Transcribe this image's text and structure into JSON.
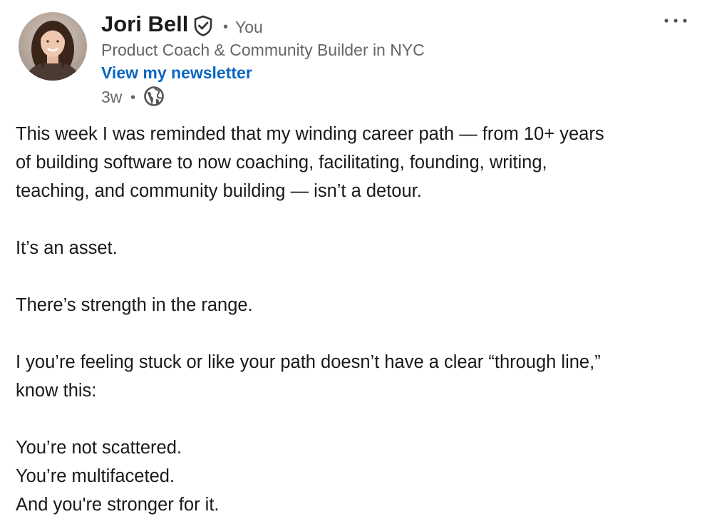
{
  "author": {
    "name": "Jori Bell",
    "relation": "You",
    "headline": "Product Coach & Community Builder in NYC",
    "newsletter_link": "View my newsletter",
    "posted_ago": "3w",
    "verified_icon": "verified-shield-icon",
    "visibility_icon": "globe-icon"
  },
  "menu": {
    "more_icon": "more-horizontal-icon"
  },
  "post": {
    "paragraphs": [
      "This week I was reminded that my winding career path — from 10+ years\nof building software to now coaching, facilitating, founding, writing,\nteaching, and community building — isn’t a detour.",
      "It’s an asset.",
      "There’s strength in the range.",
      "I you’re feeling stuck or like your path doesn’t have a clear “through line,”\nknow this:",
      "You’re not scattered.\nYou’re multifaceted.\nAnd you're stronger for it."
    ]
  },
  "colors": {
    "link": "#0a66c2",
    "secondary_text": "#666666",
    "primary_text": "#191919"
  }
}
